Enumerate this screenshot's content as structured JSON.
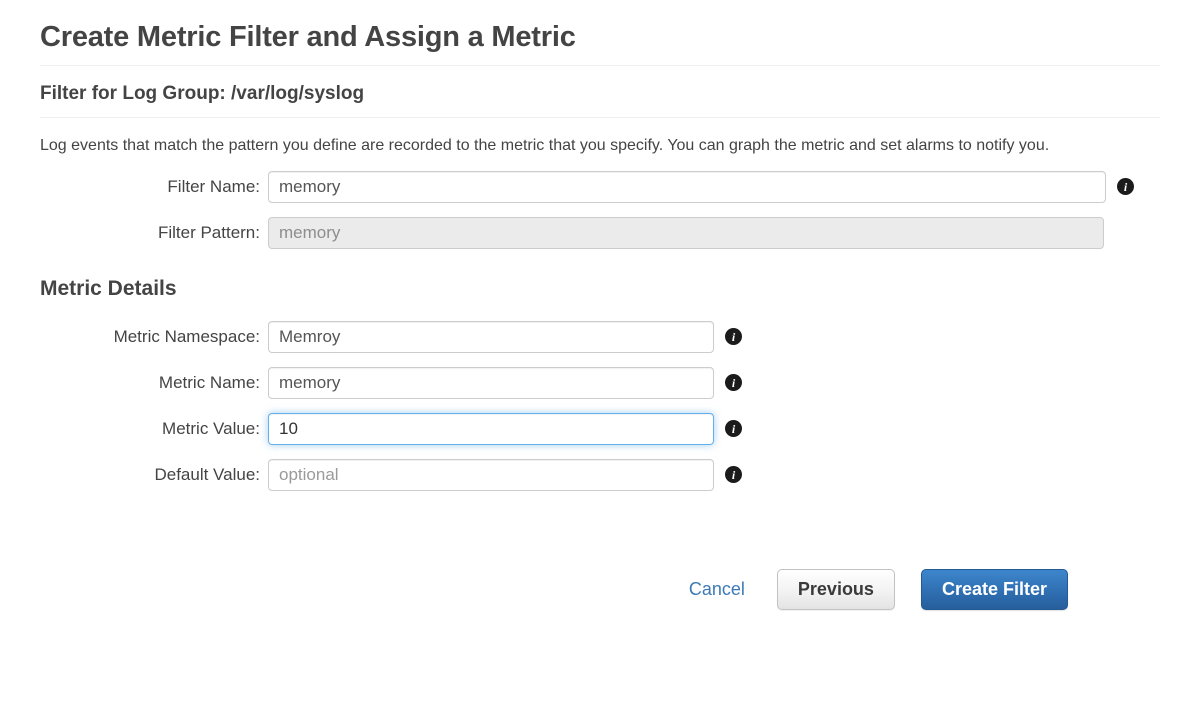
{
  "page": {
    "title": "Create Metric Filter and Assign a Metric",
    "section_title": "Filter for Log Group: /var/log/syslog",
    "description": "Log events that match the pattern you define are recorded to the metric that you specify. You can graph the metric and set alarms to notify you.",
    "metric_details_title": "Metric Details"
  },
  "filter_form": {
    "filter_name": {
      "label": "Filter Name:",
      "value": "memory",
      "placeholder": "",
      "info_icon": "info-icon"
    },
    "filter_pattern": {
      "label": "Filter Pattern:",
      "value": "memory",
      "placeholder": "",
      "disabled": true
    }
  },
  "metric_form": {
    "metric_namespace": {
      "label": "Metric Namespace:",
      "value": "Memroy",
      "placeholder": "",
      "info_icon": "info-icon"
    },
    "metric_name": {
      "label": "Metric Name:",
      "value": "memory",
      "placeholder": "",
      "info_icon": "info-icon"
    },
    "metric_value": {
      "label": "Metric Value:",
      "value": "10",
      "placeholder": "",
      "focused": true,
      "info_icon": "info-icon"
    },
    "default_value": {
      "label": "Default Value:",
      "value": "",
      "placeholder": "optional",
      "info_icon": "info-icon"
    }
  },
  "actions": {
    "cancel": "Cancel",
    "previous": "Previous",
    "create_filter": "Create Filter"
  },
  "colors": {
    "primary": "#2e6db0",
    "link": "#3d7ab5",
    "focus_border": "#66afe9",
    "text": "#444444",
    "placeholder": "#9a9a9a",
    "disabled_bg": "#ebebeb"
  },
  "info_glyph": "i"
}
